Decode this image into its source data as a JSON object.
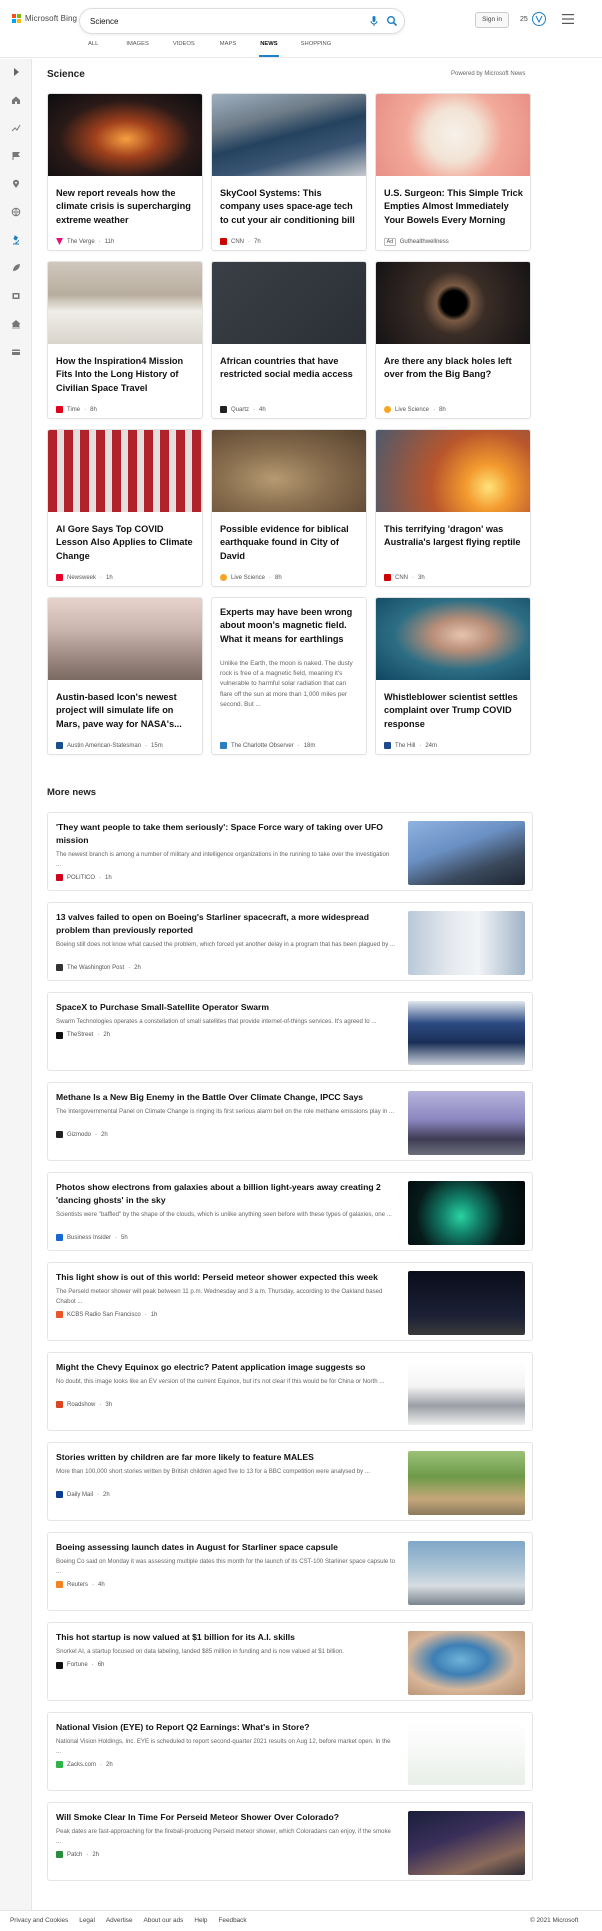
{
  "header": {
    "logo_text": "Microsoft Bing",
    "search_value": "Science",
    "signin": "Sign in",
    "rewards_points": "25",
    "tabs": [
      "ALL",
      "IMAGES",
      "VIDEOS",
      "MAPS",
      "NEWS",
      "SHOPPING"
    ],
    "active_tab": "NEWS"
  },
  "section": {
    "title": "Science",
    "powered_by": "Powered by Microsoft News"
  },
  "cards": [
    {
      "title": "New report reveals how the climate crisis is supercharging extreme weather",
      "source": "The Verge",
      "age": "11h",
      "logo_color": "#e2127a"
    },
    {
      "title": "SkyCool Systems: This company uses space-age tech to cut your air conditioning bill",
      "source": "CNN",
      "age": "7h",
      "logo_color": "#cc0000"
    },
    {
      "title": "U.S. Surgeon: This Simple Trick Empties Almost Immediately Your Bowels Every Morning",
      "source": "Guthealthwellness",
      "ad": "Ad"
    },
    {
      "title": "How the Inspiration4 Mission Fits Into the Long History of Civilian Space Travel",
      "source": "Time",
      "age": "8h",
      "logo_color": "#e1001a"
    },
    {
      "title": "African countries that have restricted social media access",
      "source": "Quartz",
      "age": "4h",
      "logo_color": "#222222"
    },
    {
      "title": "Are there any black holes left over from the Big Bang?",
      "source": "Live Science",
      "age": "8h",
      "logo_color": "#f5a623"
    },
    {
      "title": "Al Gore Says Top COVID Lesson Also Applies to Climate Change",
      "source": "Newsweek",
      "age": "1h",
      "logo_color": "#e4002b"
    },
    {
      "title": "Possible evidence for biblical earthquake found in City of David",
      "source": "Live Science",
      "age": "8h",
      "logo_color": "#f5a623"
    },
    {
      "title": "This terrifying 'dragon' was Australia's largest flying reptile",
      "source": "CNN",
      "age": "3h",
      "logo_color": "#cc0000"
    },
    {
      "title": "Austin-based Icon's newest project will simulate life on Mars, pave way for NASA's...",
      "source": "Austin American-Statesman",
      "age": "15m",
      "logo_color": "#1a4f8b"
    },
    {
      "title": "Experts may have been wrong about moon's magnetic field. What it means for earthlings",
      "snippet": "Unlike the Earth, the moon is naked. The dusty rock is free of a magnetic field, meaning it's vulnerable to harmful solar radiation that can flare off the sun at more than 1,000 miles per second. But ...",
      "source": "The Charlotte Observer",
      "age": "18m",
      "logo_color": "#2a7fc1"
    },
    {
      "title": "Whistleblower scientist settles complaint over Trump COVID response",
      "source": "The Hill",
      "age": "24m",
      "logo_color": "#1e4b8f"
    }
  ],
  "more_news": {
    "title": "More news",
    "items": [
      {
        "title": "'They want people to take them seriously': Space Force wary of taking over UFO mission",
        "snippet": "The newest branch is among a number of military and intelligence organizations in the running to take over the investigation ...",
        "source": "POLITICO",
        "age": "1h",
        "logo_color": "#d0021b"
      },
      {
        "title": "13 valves failed to open on Boeing's Starliner spacecraft, a more widespread problem than previously reported",
        "snippet": "Boeing still does not know what caused the problem, which forced yet another delay in a program that has been plagued by ...",
        "source": "The Washington Post",
        "age": "2h",
        "logo_color": "#333333"
      },
      {
        "title": "SpaceX to Purchase Small-Satellite Operator Swarm",
        "snippet": "Swarm Technologies operates a constellation of small satellites that provide internet-of-things services. It's agreed to ...",
        "source": "TheStreet",
        "age": "2h",
        "logo_color": "#111111"
      },
      {
        "title": "Methane Is a New Big Enemy in the Battle Over Climate Change, IPCC Says",
        "snippet": "The Intergovernmental Panel on Climate Change is ringing its first serious alarm bell on the role methane emissions play in ...",
        "source": "Gizmodo",
        "age": "2h",
        "logo_color": "#222222"
      },
      {
        "title": "Photos show electrons from galaxies about a billion light-years away creating 2 'dancing ghosts' in the sky",
        "snippet": "Scientists were \"baffled\" by the shape of the clouds, which is unlike anything seen before with these types of galaxies, one ...",
        "source": "Business Insider",
        "age": "5h",
        "logo_color": "#1666d6"
      },
      {
        "title": "This light show is out of this world: Perseid meteor shower expected this week",
        "snippet": "The Perseid meteor shower will peak between 11 p.m. Wednesday and 3 a.m. Thursday, according to the Oakland based Chabot ...",
        "source": "KCBS Radio San Francisco",
        "age": "1h",
        "logo_color": "#e8562a"
      },
      {
        "title": "Might the Chevy Equinox go electric? Patent application image suggests so",
        "snippet": "No doubt, this image looks like an EV version of the current Equinox, but it's not clear if this would be for China or North ...",
        "source": "Roadshow",
        "age": "3h",
        "logo_color": "#dd4422"
      },
      {
        "title": "Stories written by children are far more likely to feature MALES",
        "snippet": "More than 100,000 short stories written by British children aged five to 13 for a BBC competition were analysed by ...",
        "source": "Daily Mail",
        "age": "2h",
        "logo_color": "#0b3d91"
      },
      {
        "title": "Boeing assessing launch dates in August for Starliner space capsule",
        "snippet": "Boeing Co said on Monday it was assessing multiple dates this month for the launch of its CST-100 Starliner space capsule to ...",
        "source": "Reuters",
        "age": "4h",
        "logo_color": "#f58220"
      },
      {
        "title": "This hot startup is now valued at $1 billion for its A.I. skills",
        "snippet": "Snorkel AI, a startup focused on data labeling, landed $85 million in funding and is now valued at $1 billion.",
        "source": "Fortune",
        "age": "6h",
        "logo_color": "#111111"
      },
      {
        "title": "National Vision (EYE) to Report Q2 Earnings: What's in Store?",
        "snippet": "National Vision Holdings, Inc. EYE is scheduled to report second-quarter 2021 results on Aug 12, before market open. In the ...",
        "source": "Zacks.com",
        "age": "2h",
        "logo_color": "#2fb44a"
      },
      {
        "title": "Will Smoke Clear In Time For Perseid Meteor Shower Over Colorado?",
        "snippet": "Peak dates are fast-approaching for the fireball-producing Perseid meteor shower, which Coloradans can enjoy, if the smoke ...",
        "source": "Patch",
        "age": "2h",
        "logo_color": "#2a8c3c"
      }
    ]
  },
  "footer": {
    "links": [
      "Privacy and Cookies",
      "Legal",
      "Advertise",
      "About our ads",
      "Help",
      "Feedback"
    ],
    "copyright": "© 2021 Microsoft"
  }
}
